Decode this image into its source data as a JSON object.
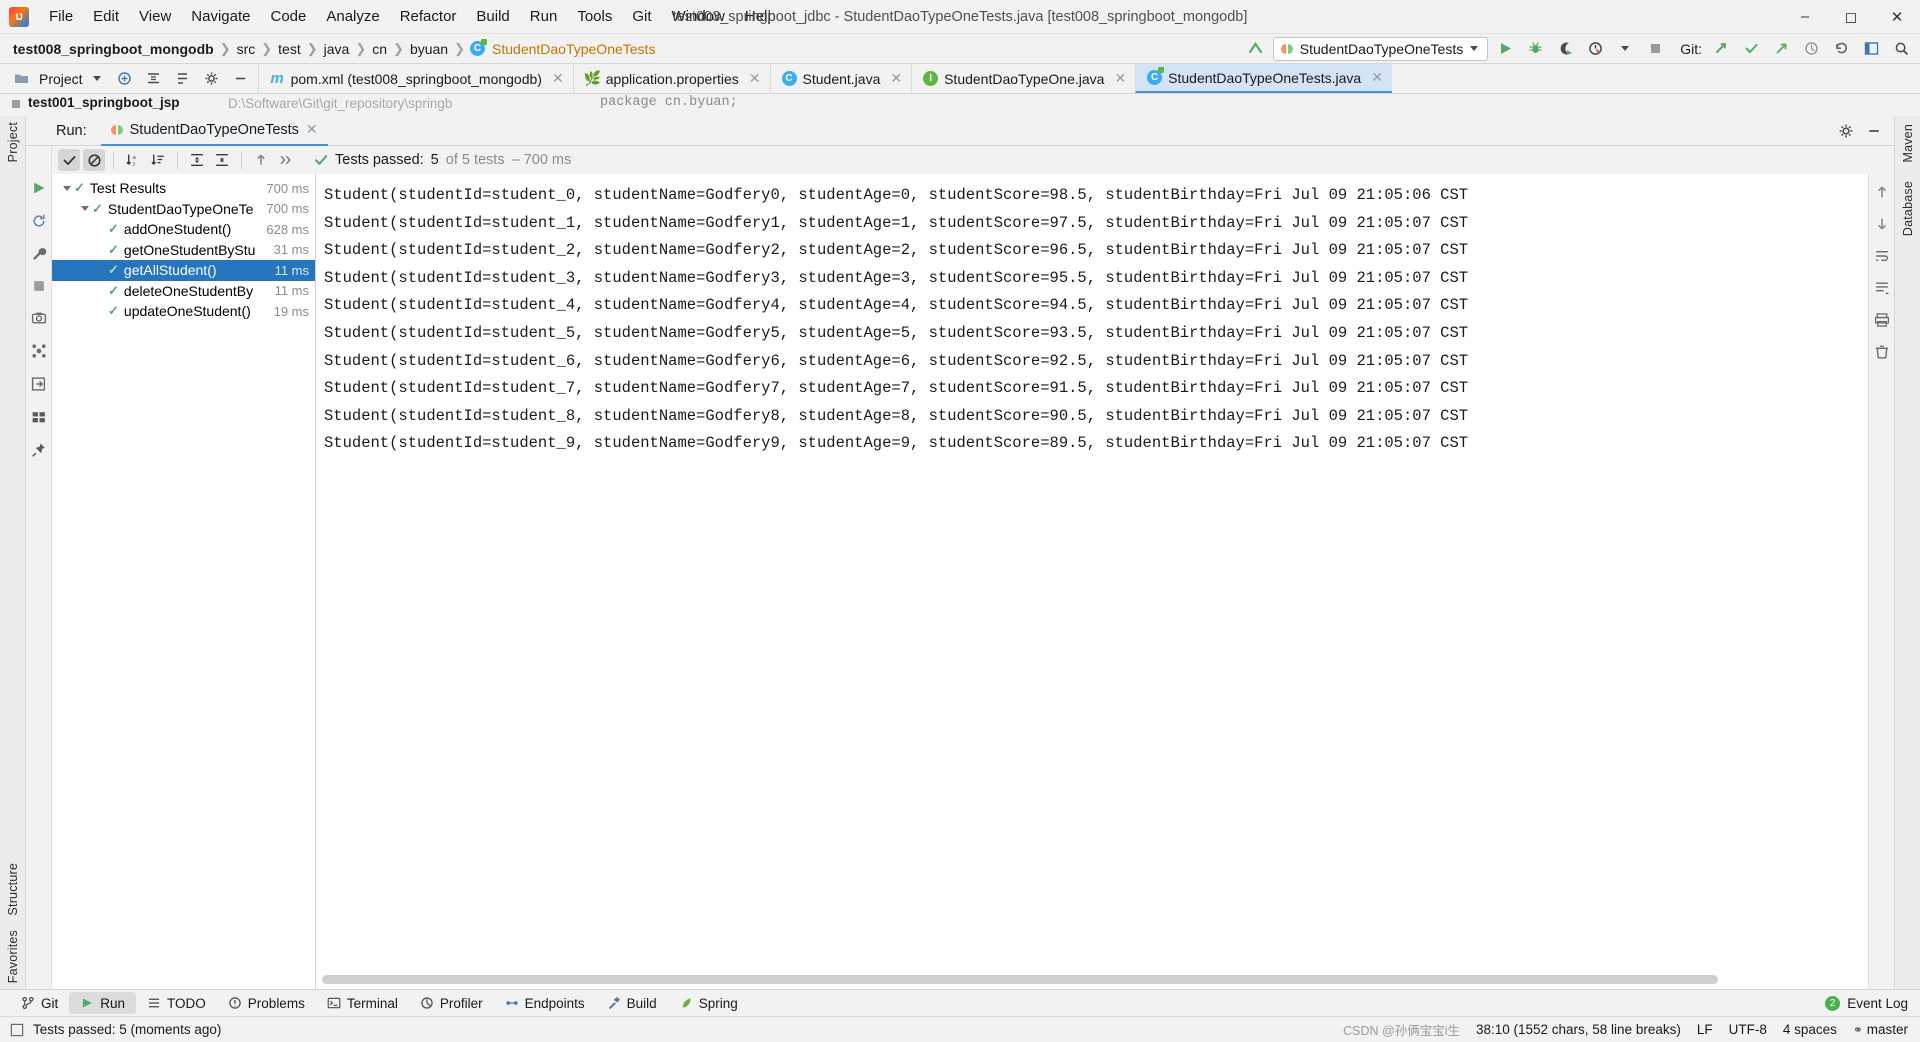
{
  "titlebar": {
    "logo_icon": "intellij-logo-icon",
    "menus": [
      "File",
      "Edit",
      "View",
      "Navigate",
      "Code",
      "Analyze",
      "Refactor",
      "Build",
      "Run",
      "Tools",
      "Git",
      "Window",
      "Help"
    ],
    "window_title": "test003_springboot_jdbc - StudentDaoTypeOneTests.java [test008_springboot_mongodb]",
    "minimize": "minimize-icon",
    "maximize": "maximize-icon",
    "close": "close-icon"
  },
  "navbar": {
    "crumbs": [
      "test008_springboot_mongodb",
      "src",
      "test",
      "java",
      "cn",
      "byuan"
    ],
    "class_crumb": "StudentDaoTypeOneTests",
    "class_icon_letter": "C",
    "run_config": "StudentDaoTypeOneTests",
    "git_label": "Git:",
    "icons": [
      "update-project-icon",
      "run-icon",
      "debug-icon",
      "run-coverage-icon",
      "profiler-icon",
      "stop-icon",
      "git-commit-icon",
      "git-checkmark-icon",
      "git-push-icon",
      "history-icon",
      "undo-icon",
      "layout-icon",
      "search-everywhere-icon"
    ]
  },
  "tabsbar": {
    "project_label": "Project",
    "tabs": [
      {
        "label": "pom.xml (test008_springboot_mongodb)",
        "icon": "maven-m-icon",
        "active": false
      },
      {
        "label": "application.properties",
        "icon": "spring-leaf-icon",
        "active": false
      },
      {
        "label": "Student.java",
        "icon": "java-class-icon",
        "active": false
      },
      {
        "label": "StudentDaoTypeOne.java",
        "icon": "java-interface-icon",
        "active": false
      },
      {
        "label": "StudentDaoTypeOneTests.java",
        "icon": "java-test-class-icon",
        "active": true
      }
    ]
  },
  "ghost_editor": {
    "file_name": "test001_springboot_jsp",
    "file_path": "D:\\Software\\Git\\git_repository\\springb",
    "code_fragment": "package cn.byuan;"
  },
  "left_strip": {
    "top_label": "Project",
    "bottom_labels": [
      "Structure",
      "Favorites"
    ]
  },
  "right_strip": {
    "labels": [
      "Maven",
      "Database"
    ]
  },
  "run_window": {
    "run_label": "Run:",
    "tab_label": "StudentDaoTypeOneTests",
    "settings_icon": "gear-icon",
    "minimize_icon": "minimize-icon",
    "toolbar_icons": [
      "rerun-icon",
      "rerun-failed-icon",
      "toggle-passed-icon",
      "sort-alpha-icon",
      "sort-duration-icon",
      "expand-all-icon",
      "collapse-all-icon",
      "prev-icon",
      "next-icon",
      "more-icon"
    ],
    "status": {
      "prefix": "Tests passed:",
      "count": "5",
      "suffix": "of 5 tests",
      "duration": "– 700 ms"
    },
    "tree": [
      {
        "label": "Test Results",
        "time": "700 ms",
        "depth": 0,
        "expandable": true,
        "selected": false
      },
      {
        "label": "StudentDaoTypeOneTe",
        "time": "700 ms",
        "depth": 1,
        "expandable": true,
        "selected": false
      },
      {
        "label": "addOneStudent()",
        "time": "628 ms",
        "depth": 2,
        "expandable": false,
        "selected": false
      },
      {
        "label": "getOneStudentByStu",
        "time": "31 ms",
        "depth": 2,
        "expandable": false,
        "selected": false
      },
      {
        "label": "getAllStudent()",
        "time": "11 ms",
        "depth": 2,
        "expandable": false,
        "selected": true
      },
      {
        "label": "deleteOneStudentBy",
        "time": "11 ms",
        "depth": 2,
        "expandable": false,
        "selected": false
      },
      {
        "label": "updateOneStudent()",
        "time": "19 ms",
        "depth": 2,
        "expandable": false,
        "selected": false
      }
    ],
    "console_lines": [
      "Student(studentId=student_0, studentName=Godfery0, studentAge=0, studentScore=98.5, studentBirthday=Fri Jul 09 21:05:06 CST",
      "Student(studentId=student_1, studentName=Godfery1, studentAge=1, studentScore=97.5, studentBirthday=Fri Jul 09 21:05:07 CST",
      "Student(studentId=student_2, studentName=Godfery2, studentAge=2, studentScore=96.5, studentBirthday=Fri Jul 09 21:05:07 CST",
      "Student(studentId=student_3, studentName=Godfery3, studentAge=3, studentScore=95.5, studentBirthday=Fri Jul 09 21:05:07 CST",
      "Student(studentId=student_4, studentName=Godfery4, studentAge=4, studentScore=94.5, studentBirthday=Fri Jul 09 21:05:07 CST",
      "Student(studentId=student_5, studentName=Godfery5, studentAge=5, studentScore=93.5, studentBirthday=Fri Jul 09 21:05:07 CST",
      "Student(studentId=student_6, studentName=Godfery6, studentAge=6, studentScore=92.5, studentBirthday=Fri Jul 09 21:05:07 CST",
      "Student(studentId=student_7, studentName=Godfery7, studentAge=7, studentScore=91.5, studentBirthday=Fri Jul 09 21:05:07 CST",
      "Student(studentId=student_8, studentName=Godfery8, studentAge=8, studentScore=90.5, studentBirthday=Fri Jul 09 21:05:07 CST",
      "Student(studentId=student_9, studentName=Godfery9, studentAge=9, studentScore=89.5, studentBirthday=Fri Jul 09 21:05:07 CST"
    ]
  },
  "bottom_bar": {
    "items": [
      {
        "label": "Git",
        "icon": "git-branch-icon",
        "active": false
      },
      {
        "label": "Run",
        "icon": "run-icon",
        "active": true
      },
      {
        "label": "TODO",
        "icon": "todo-icon",
        "active": false
      },
      {
        "label": "Problems",
        "icon": "problems-icon",
        "active": false
      },
      {
        "label": "Terminal",
        "icon": "terminal-icon",
        "active": false
      },
      {
        "label": "Profiler",
        "icon": "profiler-icon",
        "active": false
      },
      {
        "label": "Endpoints",
        "icon": "endpoints-icon",
        "active": false
      },
      {
        "label": "Build",
        "icon": "build-hammer-icon",
        "active": false
      },
      {
        "label": "Spring",
        "icon": "spring-leaf-icon",
        "active": false
      }
    ],
    "event_log": "Event Log",
    "event_count": "2"
  },
  "statusbar": {
    "message": "Tests passed: 5 (moments ago)",
    "caret": "38:10 (1552 chars, 58 line breaks)",
    "line_sep": "LF",
    "encoding": "UTF-8",
    "indent": "4 spaces",
    "branch": "master",
    "watermark": "CSDN @孙俩宝宝i生"
  },
  "colors": {
    "accent_blue": "#2675bf",
    "tab_active_bg": "#d3e4f7",
    "green": "#59a869",
    "crumb_orange": "#c47500"
  }
}
